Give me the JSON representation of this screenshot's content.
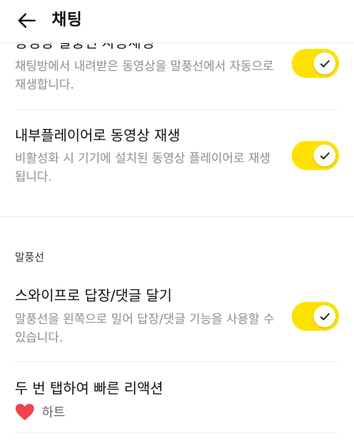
{
  "header": {
    "title": "채팅",
    "back_icon": "arrow-left-icon"
  },
  "settings": {
    "auto_play": {
      "title": "동영상 말풍선 자동재생",
      "description": "채팅방에서 내려받은 동영상을 말풍선에서 자동으로 재생합니다.",
      "enabled": true
    },
    "internal_player": {
      "title": "내부플레이어로 동영상 재생",
      "description": "비활성화 시 기기에 설치된 동영상 플레이어로 재생됩니다.",
      "enabled": true
    }
  },
  "bubble_section": {
    "header": "말풍선",
    "swipe_reply": {
      "title": "스와이프로 답장/댓글 달기",
      "description": "말풍선을 왼쪽으로 밀어 답장/댓글 기능을 사용할 수 있습니다.",
      "enabled": true
    },
    "double_tap": {
      "title": "두 번 탭하여 빠른 리액션",
      "reaction_label": "하트",
      "reaction_icon": "heart-icon"
    }
  },
  "colors": {
    "toggle_on": "#ffe100",
    "heart": "#f0424c"
  }
}
